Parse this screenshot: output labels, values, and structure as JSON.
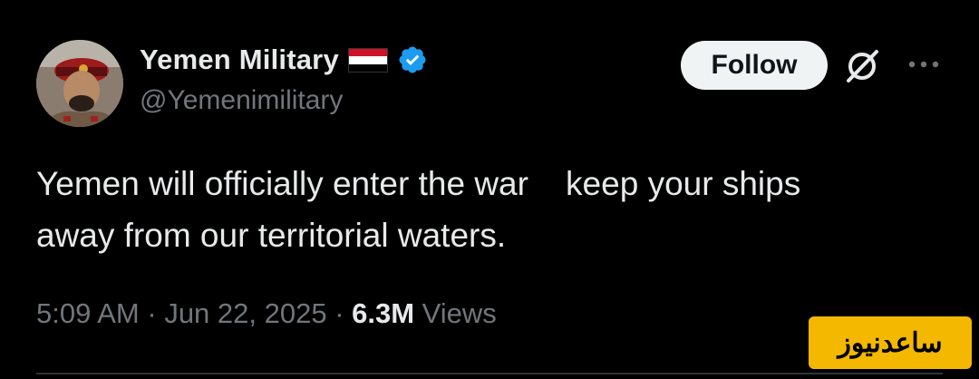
{
  "author": {
    "display_name": "Yemen Military",
    "handle": "@Yemenimilitary",
    "flag_icon": "yemen-flag",
    "verified_icon": "verified-badge",
    "verified_color": "#1d9bf0"
  },
  "actions": {
    "follow_label": "Follow",
    "grok_icon": "grok-icon",
    "more_icon": "more-icon"
  },
  "tweet": {
    "line1": "Yemen will officially enter the war    keep your ships",
    "line2": "away from our territorial waters."
  },
  "meta": {
    "time": "5:09 AM",
    "sep1": " · ",
    "date": "Jun 22, 2025",
    "sep2": " · ",
    "views_count": "6.3M",
    "views_label": " Views"
  },
  "watermark": {
    "text": "ساعدنیوز",
    "color": "#f5b800"
  }
}
